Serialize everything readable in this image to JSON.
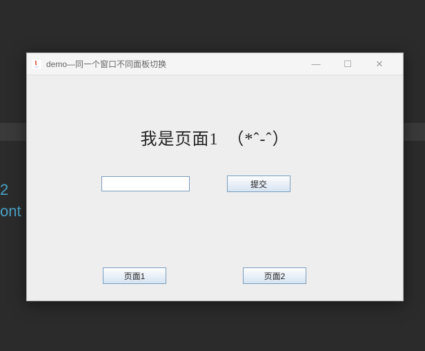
{
  "background": {
    "partial_text_line1": "2",
    "partial_text_line2": "ont"
  },
  "window": {
    "title": "demo—同一个窗口不同面板切换",
    "controls": {
      "minimize": "—",
      "maximize": "☐",
      "close": "✕"
    }
  },
  "content": {
    "heading": "我是页面1　（*ˆ-ˆ）",
    "input_value": "",
    "submit_label": "提交",
    "page1_label": "页面1",
    "page2_label": "页面2"
  }
}
